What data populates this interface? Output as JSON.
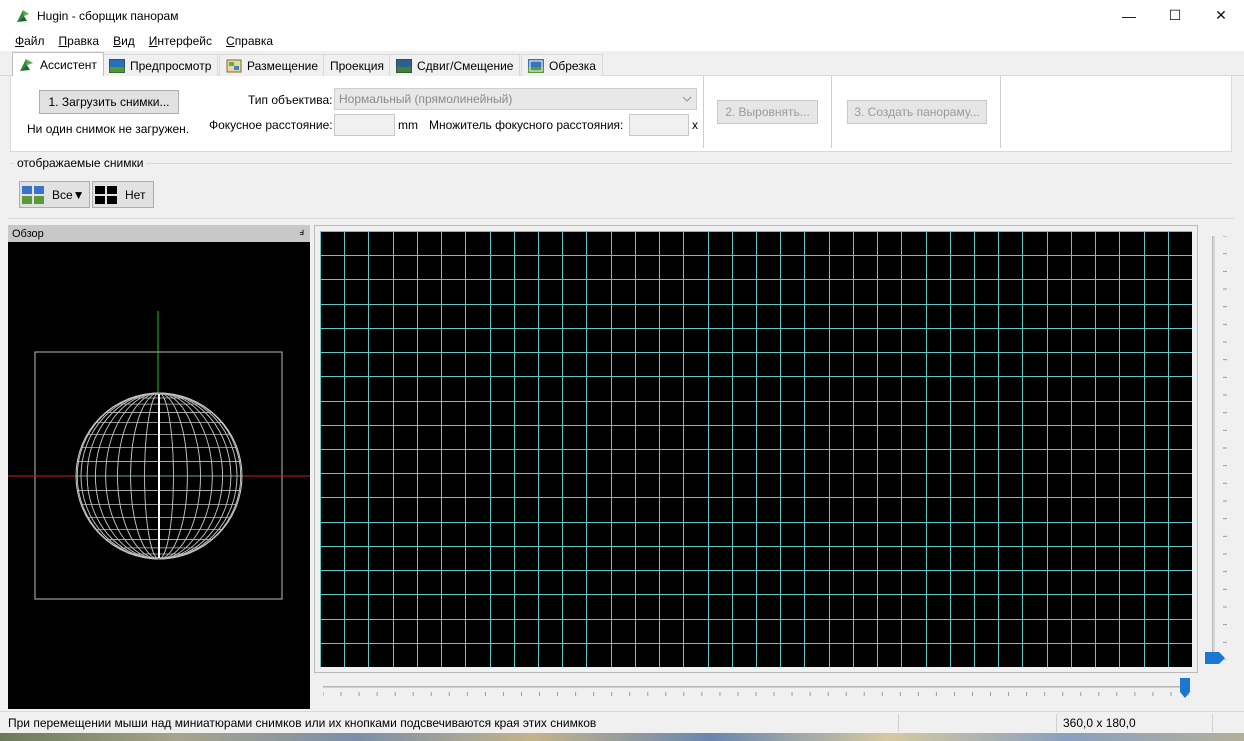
{
  "window": {
    "title": "Hugin - сборщик панорам",
    "controls": {
      "minimize": "—",
      "maximize": "☐",
      "close": "✕"
    }
  },
  "menu": [
    {
      "label": "Файл",
      "accel": "Ф",
      "rest": "айл"
    },
    {
      "label": "Правка",
      "accel": "П",
      "rest": "равка"
    },
    {
      "label": "Вид",
      "accel": "В",
      "rest": "ид"
    },
    {
      "label": "Интерфейс",
      "accel": "И",
      "rest": "нтерфейс"
    },
    {
      "label": "Справка",
      "accel": "С",
      "rest": "правка"
    }
  ],
  "tabs": [
    {
      "label": "Ассистент",
      "icon": "hugin-icon",
      "active": true
    },
    {
      "label": "Предпросмотр",
      "icon": "preview-icon"
    },
    {
      "label": "Размещение",
      "icon": "layout-icon"
    },
    {
      "label": "Проекция",
      "icon": ""
    },
    {
      "label": "Сдвиг/Смещение",
      "icon": "move-icon"
    },
    {
      "label": "Обрезка",
      "icon": "crop-icon"
    }
  ],
  "assistant": {
    "load_button": "1. Загрузить снимки...",
    "status": "Ни один снимок не загружен.",
    "lens_type_label": "Тип объектива:",
    "lens_type_value": "Нормальный (прямолинейный)",
    "focal_length_label": "Фокусное расстояние:",
    "focal_length_value": "",
    "focal_length_unit": "mm",
    "crop_factor_label": "Множитель фокусного расстояния:",
    "crop_factor_value": "",
    "crop_factor_unit": "x",
    "align_button": "2. Выровнять...",
    "create_button": "3. Создать панораму..."
  },
  "displayed_images": {
    "group_label": "отображаемые снимки",
    "all_button": "Все▼",
    "none_button": "Нет"
  },
  "overview": {
    "title": "Обзор",
    "pin": "ⅎ"
  },
  "statusbar": {
    "message": "При перемещении мыши над миниатюрами снимков или их кнопками подсвечиваются края этих снимков",
    "field_of_view": "360,0 x 180,0"
  },
  "colors": {
    "grid_line": "#5fc8c8",
    "axis_x": "#c81e1e",
    "axis_y": "#20c020",
    "slider_thumb": "#1a78d0"
  }
}
